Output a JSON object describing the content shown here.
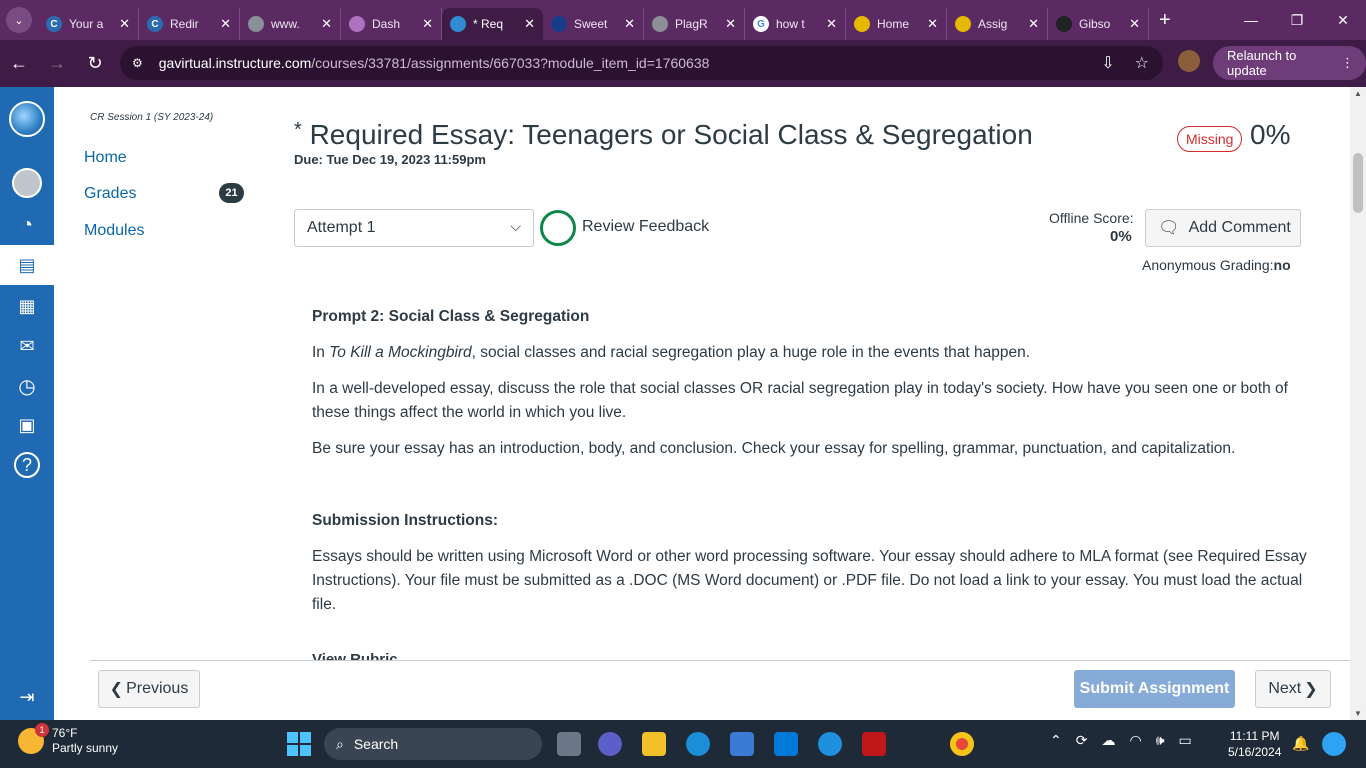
{
  "browser": {
    "tabs": [
      {
        "title": "Your a",
        "fav_color": "#2b6cb0",
        "fav": "C"
      },
      {
        "title": "Redir",
        "fav_color": "#2b6cb0",
        "fav": "C"
      },
      {
        "title": "www.",
        "fav_color": "#8a8f98",
        "fav": ""
      },
      {
        "title": "Dash",
        "fav_color": "#b070c0",
        "fav": ""
      },
      {
        "title": "* Req",
        "fav_color": "#2e8bd1",
        "fav": ""
      },
      {
        "title": "Sweet",
        "fav_color": "#1a3b8a",
        "fav": ""
      },
      {
        "title": "PlagR",
        "fav_color": "#8a8f98",
        "fav": ""
      },
      {
        "title": "how t",
        "fav_color": "#ffffff",
        "fav": "G"
      },
      {
        "title": "Home",
        "fav_color": "#e6b800",
        "fav": ""
      },
      {
        "title": "Assig",
        "fav_color": "#e6b800",
        "fav": ""
      },
      {
        "title": "Gibso",
        "fav_color": "#222222",
        "fav": ""
      }
    ],
    "active_tab_index": 4,
    "url_host": "gavirtual.instructure.com",
    "url_path": "/courses/33781/assignments/667033?module_item_id=1760638",
    "relaunch_label": "Relaunch to update"
  },
  "course_nav": {
    "term": "CR Session 1 (SY 2023-24)",
    "home": "Home",
    "grades": "Grades",
    "grades_badge": "21",
    "modules": "Modules"
  },
  "assignment": {
    "title": "Required Essay: Teenagers or Social Class & Segregation",
    "title_prefix": "*",
    "due": "Due: Tue Dec 19, 2023 11:59pm",
    "status": "Missing",
    "score_pct": "0%",
    "attempt": "Attempt 1",
    "review_feedback": "Review Feedback",
    "offline_score_label": "Offline Score:",
    "offline_score_value": "0%",
    "add_comment": "Add Comment",
    "anon_label": "Anonymous Grading:",
    "anon_value": "no"
  },
  "content": {
    "prompt_heading": "Prompt 2:  Social Class & Segregation",
    "p1_book": "To Kill a Mockingbird",
    "p1_rest": ", social classes and racial segregation play a huge role in the events that happen.",
    "p1_start": "In ",
    "p2": "In a well-developed essay, discuss the role that social classes OR racial segregation play in today's society. How have you seen one or both of these things affect the world in which you live.",
    "p3": "Be sure your essay has an introduction, body, and conclusion. Check your essay for spelling, grammar, punctuation, and capitalization.",
    "submission_heading": "Submission Instructions:",
    "p4": "Essays should be written using Microsoft Word or other word processing software.  Your essay should adhere to MLA format (see Required Essay Instructions).  Your file must be submitted as a .DOC (MS Word document) or .PDF file.  Do not load a link to your essay.  You must load the actual file.",
    "cut_heading": "View Rubric"
  },
  "footer": {
    "previous": "Previous",
    "submit": "Submit Assignment",
    "next": "Next"
  },
  "taskbar": {
    "temp": "76°F",
    "weather": "Partly sunny",
    "weather_badge": "1",
    "search": "Search",
    "time": "11:11 PM",
    "date": "5/16/2024"
  }
}
